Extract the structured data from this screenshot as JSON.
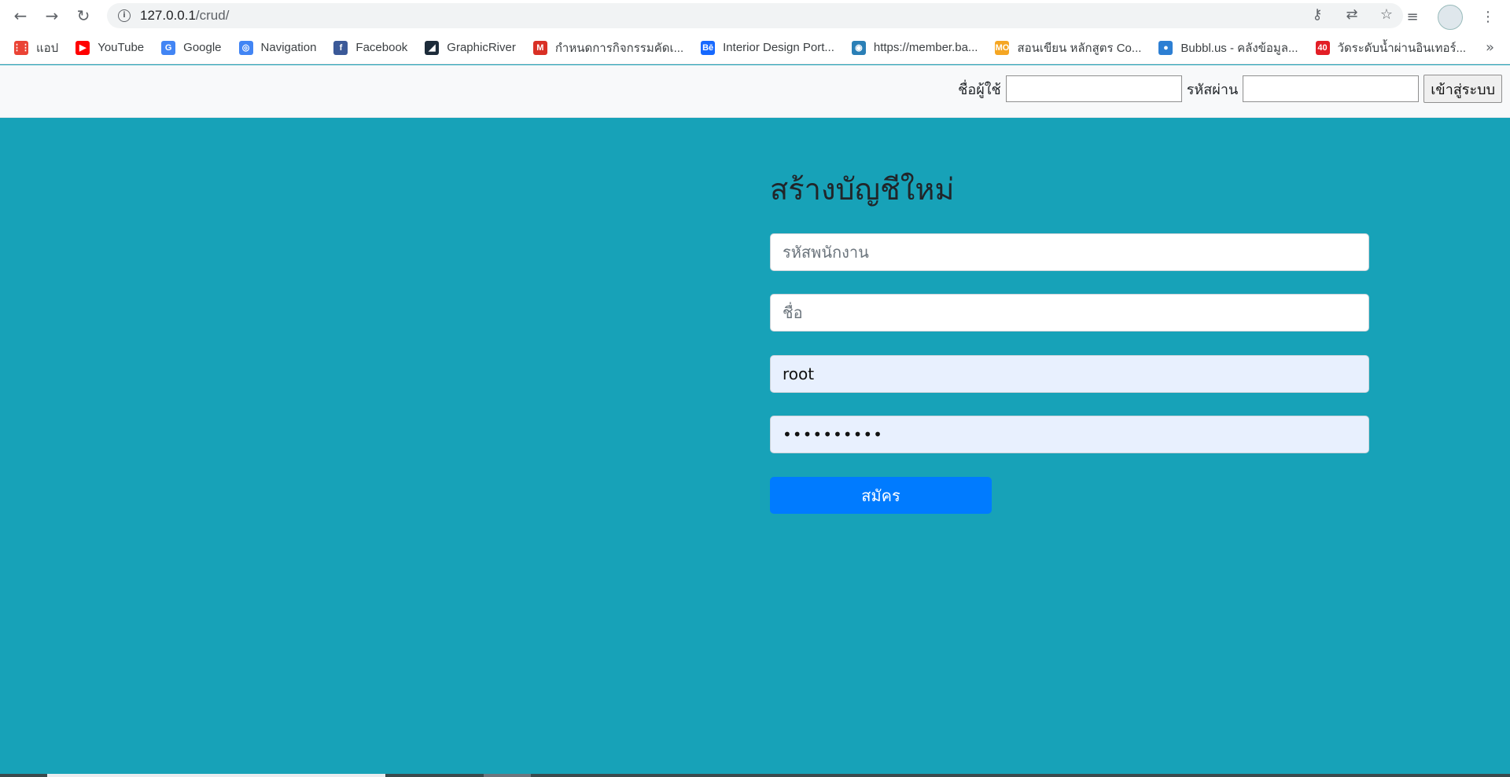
{
  "browser": {
    "url_host": "127.0.0.1",
    "url_path": "/crud/",
    "bookmarks": [
      {
        "label": "แอป",
        "icon": "apps-grid-icon",
        "color": "#ea4335"
      },
      {
        "label": "YouTube",
        "icon": "youtube-icon",
        "color": "#ff0000"
      },
      {
        "label": "Google",
        "icon": "google-icon",
        "color": "#4285f4"
      },
      {
        "label": "Navigation",
        "icon": "navigation-icon",
        "color": "#4285f4"
      },
      {
        "label": "Facebook",
        "icon": "facebook-icon",
        "color": "#3b5998"
      },
      {
        "label": "GraphicRiver",
        "icon": "graphicriver-icon",
        "color": "#1c2b39"
      },
      {
        "label": "กำหนดการกิจกรรมคัดเ...",
        "icon": "gmail-icon",
        "color": "#d93025"
      },
      {
        "label": "Interior Design Port...",
        "icon": "behance-icon",
        "color": "#1769ff"
      },
      {
        "label": "https://member.ba...",
        "icon": "member-site-icon",
        "color": "#2a7fb6"
      },
      {
        "label": "สอนเขียน หลักสูตร Co...",
        "icon": "mo-icon",
        "color": "#f5a623"
      },
      {
        "label": "Bubbl.us - คลังข้อมูล...",
        "icon": "bubblus-icon",
        "color": "#2d7fd3"
      },
      {
        "label": "วัดระดับน้ำผ่านอินเทอร์...",
        "icon": "forty-icon",
        "color": "#e21e26"
      }
    ]
  },
  "topbar": {
    "username_label": "ชื่อผู้ใช้",
    "password_label": "รหัสผ่าน",
    "login_button": "เข้าสู่ระบบ"
  },
  "form": {
    "title": "สร้างบัญชีใหม่",
    "employee_id_placeholder": "รหัสพนักงาน",
    "name_placeholder": "ชื่อ",
    "username_value": "root",
    "password_value": "••••••••••",
    "submit_label": "สมัคร"
  },
  "colors": {
    "background": "#17a2b8",
    "button": "#007bff"
  }
}
